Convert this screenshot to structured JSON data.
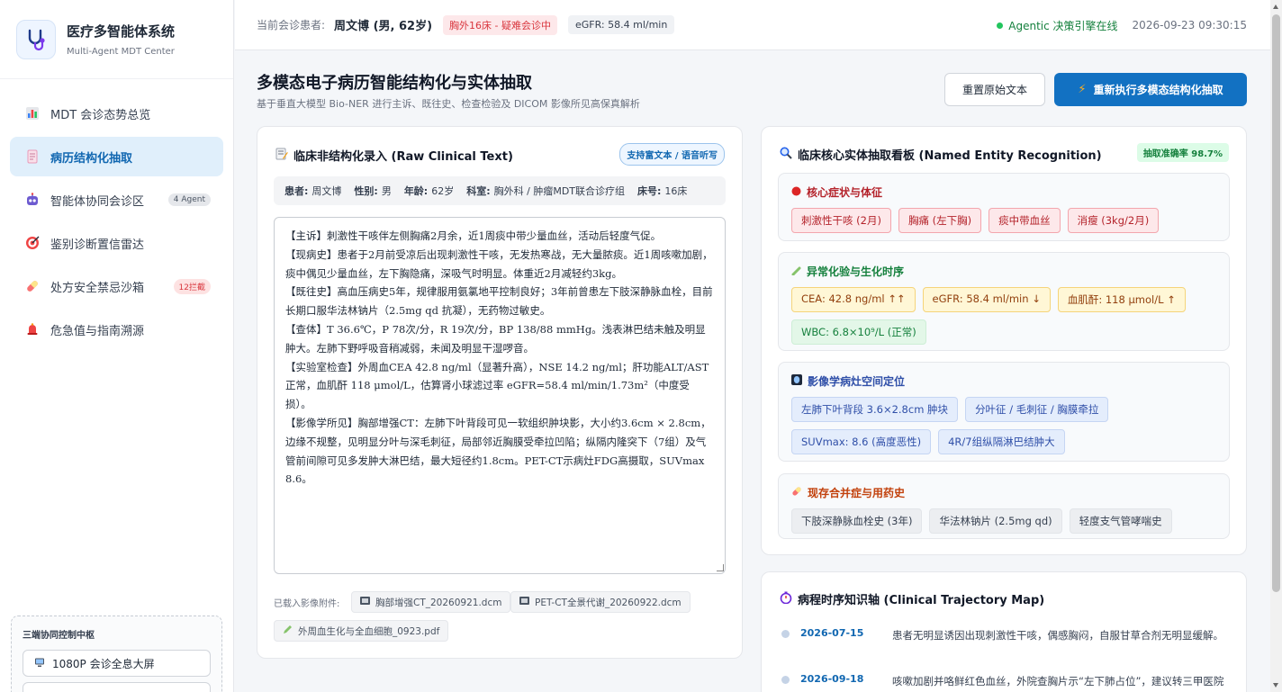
{
  "app": {
    "title": "医疗多智能体系统",
    "subtitle": "Multi-Agent MDT Center"
  },
  "sidebar": {
    "items": [
      {
        "label": "MDT 会诊态势总览",
        "icon": "bar-chart-icon"
      },
      {
        "label": "病历结构化抽取",
        "icon": "document-icon",
        "active": true
      },
      {
        "label": "智能体协同会诊区",
        "icon": "robot-icon",
        "badge": "4 Agent"
      },
      {
        "label": "鉴别诊断置信雷达",
        "icon": "target-icon"
      },
      {
        "label": "处方安全禁忌沙箱",
        "icon": "pill-icon",
        "badge": "12拦截"
      },
      {
        "label": "危急值与指南溯源",
        "icon": "alarm-bell-icon"
      }
    ],
    "control": {
      "title": "三端协同控制中枢",
      "button": "1080P 会诊全息大屏"
    }
  },
  "topbar": {
    "patient_label": "当前会诊患者:",
    "patient": "周文博 (男, 62岁)",
    "ward_tag": "胸外16床 - 疑难会诊中",
    "egfr_tag": "eGFR: 58.4 ml/min",
    "engine_status": "Agentic 决策引擎在线",
    "datetime": "2026-09-23 09:30:15"
  },
  "page": {
    "title": "多模态电子病历智能结构化与实体抽取",
    "subtitle": "基于垂直大模型 Bio-NER 进行主诉、既往史、检查检验及 DICOM 影像所见高保真解析",
    "reset_button": "重置原始文本",
    "run_button": "重新执行多模态结构化抽取"
  },
  "raw": {
    "title": "临床非结构化录入 (Raw Clinical Text)",
    "badge": "支持富文本 / 语音听写",
    "info": {
      "patient_k": "患者:",
      "patient_v": "周文博",
      "sex_k": "性别:",
      "sex_v": "男",
      "age_k": "年龄:",
      "age_v": "62岁",
      "dept_k": "科室:",
      "dept_v": "胸外科 / 肿瘤MDT联合诊疗组",
      "bed_k": "床号:",
      "bed_v": "16床"
    },
    "text": "【主诉】刺激性干咳伴左侧胸痛2月余，近1周痰中带少量血丝，活动后轻度气促。\n【现病史】患者于2月前受凉后出现刺激性干咳，无发热寒战，无大量脓痰。近1周咳嗽加剧，痰中偶见少量血丝，左下胸隐痛，深吸气时明显。体重近2月减轻约3kg。\n【既往史】高血压病史5年，规律服用氨氯地平控制良好；3年前曾患左下肢深静脉血栓，目前长期口服华法林钠片（2.5mg qd 抗凝），无药物过敏史。\n【查体】T 36.6℃，P 78次/分，R 19次/分，BP 138/88 mmHg。浅表淋巴结未触及明显肿大。左肺下野呼吸音稍减弱，未闻及明显干湿啰音。\n【实验室检查】外周血CEA 42.8 ng/ml（显著升高），NSE 14.2 ng/ml；肝功能ALT/AST正常，血肌酐 118 μmol/L，估算肾小球滤过率 eGFR=58.4 ml/min/1.73m²（中度受损）。\n【影像学所见】胸部增强CT：左肺下叶背段可见一软组织肿块影，大小约3.6cm × 2.8cm，边缘不规整，见明显分叶与深毛刺征，局部邻近胸膜受牵拉凹陷；纵隔内隆突下（7组）及气管前间隙可见多发肿大淋巴结，最大短径约1.8cm。PET-CT示病灶FDG高摄取，SUVmax 8.6。",
    "attachments_label": "已载入影像附件:",
    "attachments": [
      {
        "name": "胸部增强CT_20260921.dcm",
        "icon": "film-icon"
      },
      {
        "name": "PET-CT全景代谢_20260922.dcm",
        "icon": "film-icon"
      },
      {
        "name": "外周血生化与全血细胞_0923.pdf",
        "icon": "pencil-icon"
      }
    ]
  },
  "ner": {
    "title": "临床核心实体抽取看板 (Named Entity Recognition)",
    "accuracy": "抽取准确率 98.7%",
    "groups": [
      {
        "title": "核心症状与体征",
        "color": "#b4232b",
        "icon": "red-dot-icon",
        "chips": [
          "刺激性干咳 (2月)",
          "胸痛 (左下胸)",
          "痰中带血丝",
          "消瘦 (3kg/2月)"
        ]
      },
      {
        "title": "异常化验与生化时序",
        "color": "#15803d",
        "icon": "test-tube-icon",
        "chips": [
          "CEA: 42.8 ng/ml ↑↑",
          "eGFR: 58.4 ml/min ↓",
          "血肌酐: 118 μmol/L ↑",
          "WBC: 6.8×10⁹/L (正常)"
        ]
      },
      {
        "title": "影像学病灶空间定位",
        "color": "#2f4fa8",
        "icon": "x-ray-icon",
        "chips": [
          "左肺下叶背段 3.6×2.8cm 肿块",
          "分叶征 / 毛刺征 / 胸膜牵拉",
          "SUVmax: 8.6 (高度恶性)",
          "4R/7组纵隔淋巴结肿大"
        ]
      },
      {
        "title": "现存合并症与用药史",
        "color": "#c2410c",
        "icon": "pill-icon",
        "chips": [
          "下肢深静脉血栓史 (3年)",
          "华法林钠片 (2.5mg qd)",
          "轻度支气管哮喘史"
        ]
      }
    ]
  },
  "timeline": {
    "title": "病程时序知识轴 (Clinical Trajectory Map)",
    "events": [
      {
        "date": "2026-07-15",
        "text": "患者无明显诱因出现刺激性干咳，偶感胸闷，自服甘草合剂无明显缓解。"
      },
      {
        "date": "2026-09-18",
        "text": "咳嗽加剧并咯鲜红色血丝，外院查胸片示“左下肺占位”，建议转三甲医院进一步诊治。"
      }
    ]
  },
  "colors": {
    "primary": "#1271c2",
    "active_bg": "#e0effb",
    "online": "#22c55e"
  }
}
